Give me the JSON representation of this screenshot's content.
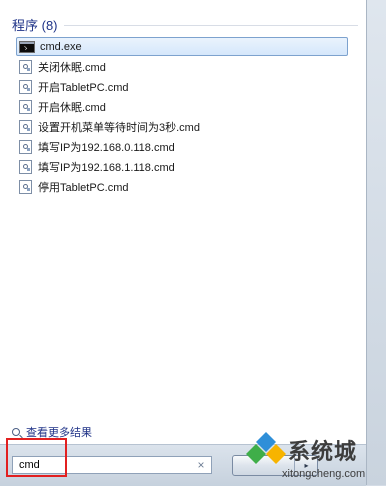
{
  "programs": {
    "header": "程序 (8)",
    "items": [
      {
        "label": "cmd.exe",
        "icon": "cmd-icon",
        "selected": true
      },
      {
        "label": "关闭休眠.cmd",
        "icon": "script-file-icon"
      },
      {
        "label": "开启TabletPC.cmd",
        "icon": "script-file-icon"
      },
      {
        "label": "开启休眠.cmd",
        "icon": "script-file-icon"
      },
      {
        "label": "设置开机菜单等待时间为3秒.cmd",
        "icon": "script-file-icon"
      },
      {
        "label": "填写IP为192.168.0.118.cmd",
        "icon": "script-file-icon"
      },
      {
        "label": "填写IP为192.168.1.118.cmd",
        "icon": "script-file-icon"
      },
      {
        "label": "停用TabletPC.cmd",
        "icon": "script-file-icon"
      }
    ]
  },
  "more_results": {
    "label": "查看更多结果",
    "icon": "search-icon"
  },
  "search": {
    "value": "cmd",
    "clear_icon": "close-icon",
    "highlight_color": "#e22020"
  },
  "shutdown": {
    "arrow": "▸"
  },
  "watermark": {
    "title": "系统城",
    "url": "xitongcheng.com",
    "colors": [
      "#2f8fd8",
      "#3fae49",
      "#f7b400"
    ]
  }
}
